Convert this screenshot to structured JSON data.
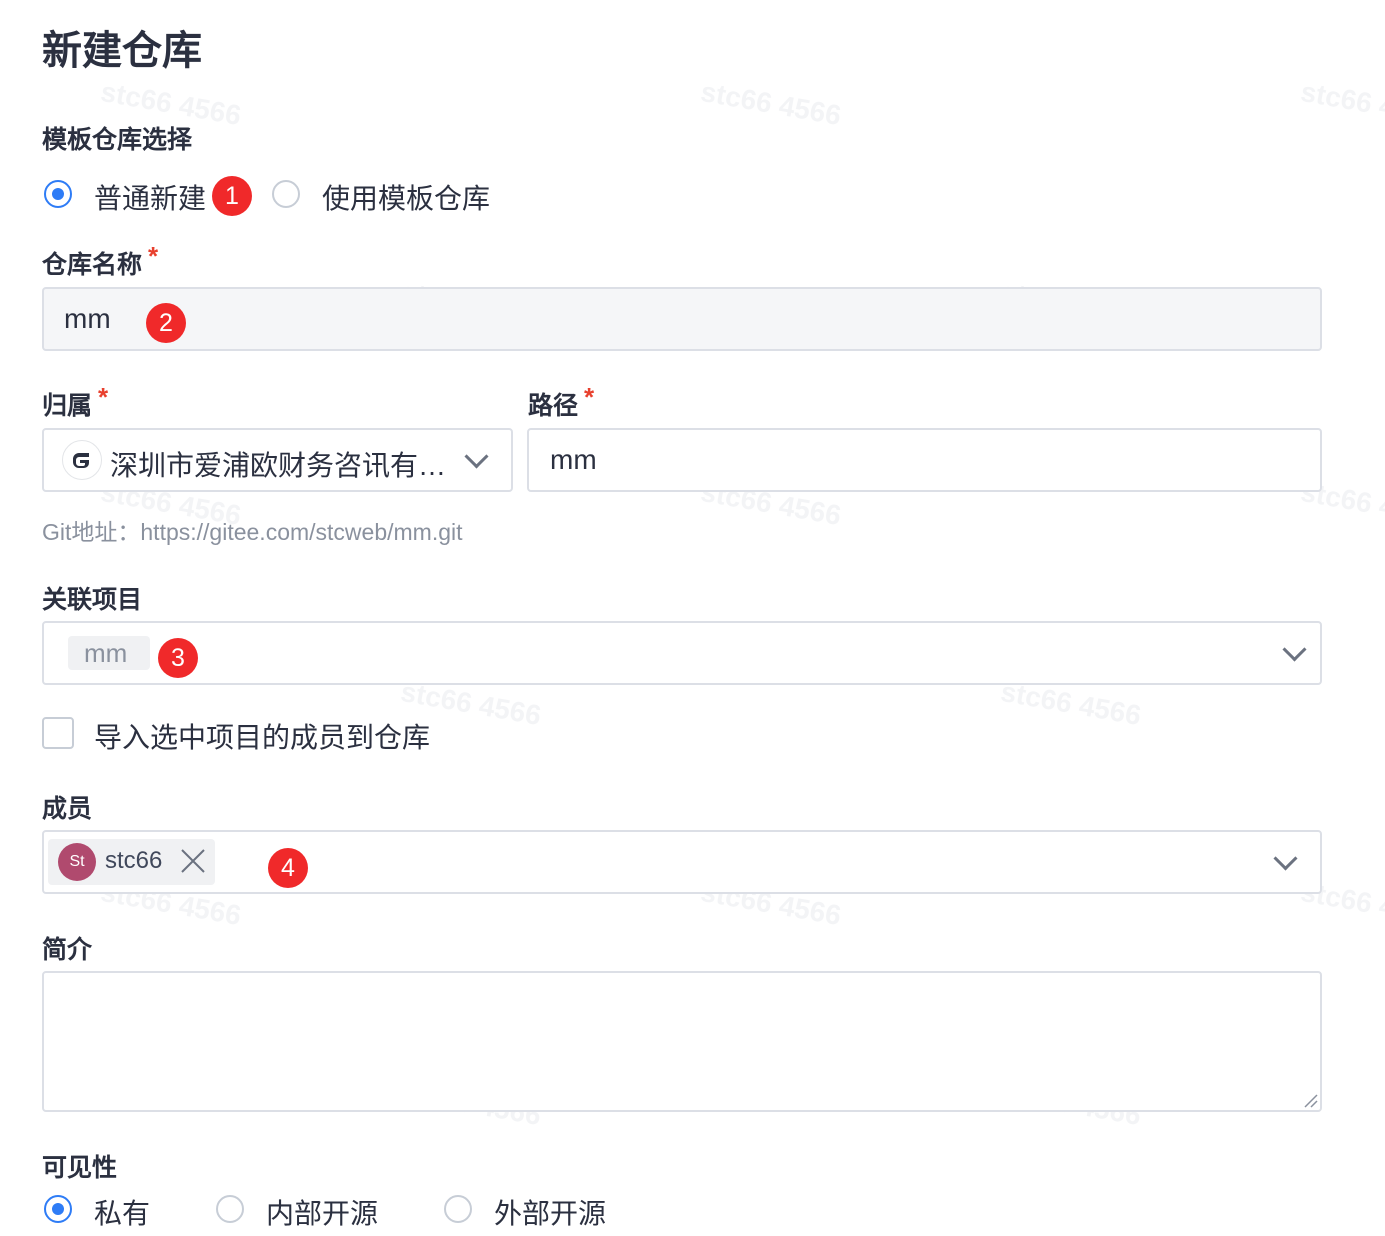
{
  "page": {
    "title": "新建仓库"
  },
  "watermark": "stc66 4566",
  "template_select": {
    "label": "模板仓库选择",
    "options": [
      {
        "label": "普通新建",
        "selected": true
      },
      {
        "label": "使用模板仓库",
        "selected": false
      }
    ]
  },
  "repo_name": {
    "label": "仓库名称",
    "required_mark": "*",
    "value": "mm"
  },
  "owner": {
    "label": "归属",
    "required_mark": "*",
    "value": "深圳市爱浦欧财务咨讯有…",
    "icon": "gitee-logo-icon"
  },
  "path": {
    "label": "路径",
    "required_mark": "*",
    "value": "mm"
  },
  "git_address": {
    "text": "Git地址：https://gitee.com/stcweb/mm.git"
  },
  "related_project": {
    "label": "关联项目",
    "selected_tag": "mm"
  },
  "import_members": {
    "label": "导入选中项目的成员到仓库",
    "checked": false
  },
  "members": {
    "label": "成员",
    "tags": [
      {
        "avatar_text": "St",
        "name": "stc66"
      }
    ]
  },
  "intro": {
    "label": "简介",
    "value": ""
  },
  "visibility": {
    "label": "可见性",
    "options": [
      {
        "label": "私有",
        "selected": true
      },
      {
        "label": "内部开源",
        "selected": false
      },
      {
        "label": "外部开源",
        "selected": false
      }
    ]
  },
  "annotations": [
    "1",
    "2",
    "3",
    "4"
  ],
  "colors": {
    "accent": "#2e7cf6",
    "required": "#e8402e",
    "badge": "#f0292a",
    "avatar": "#b04a6e"
  }
}
